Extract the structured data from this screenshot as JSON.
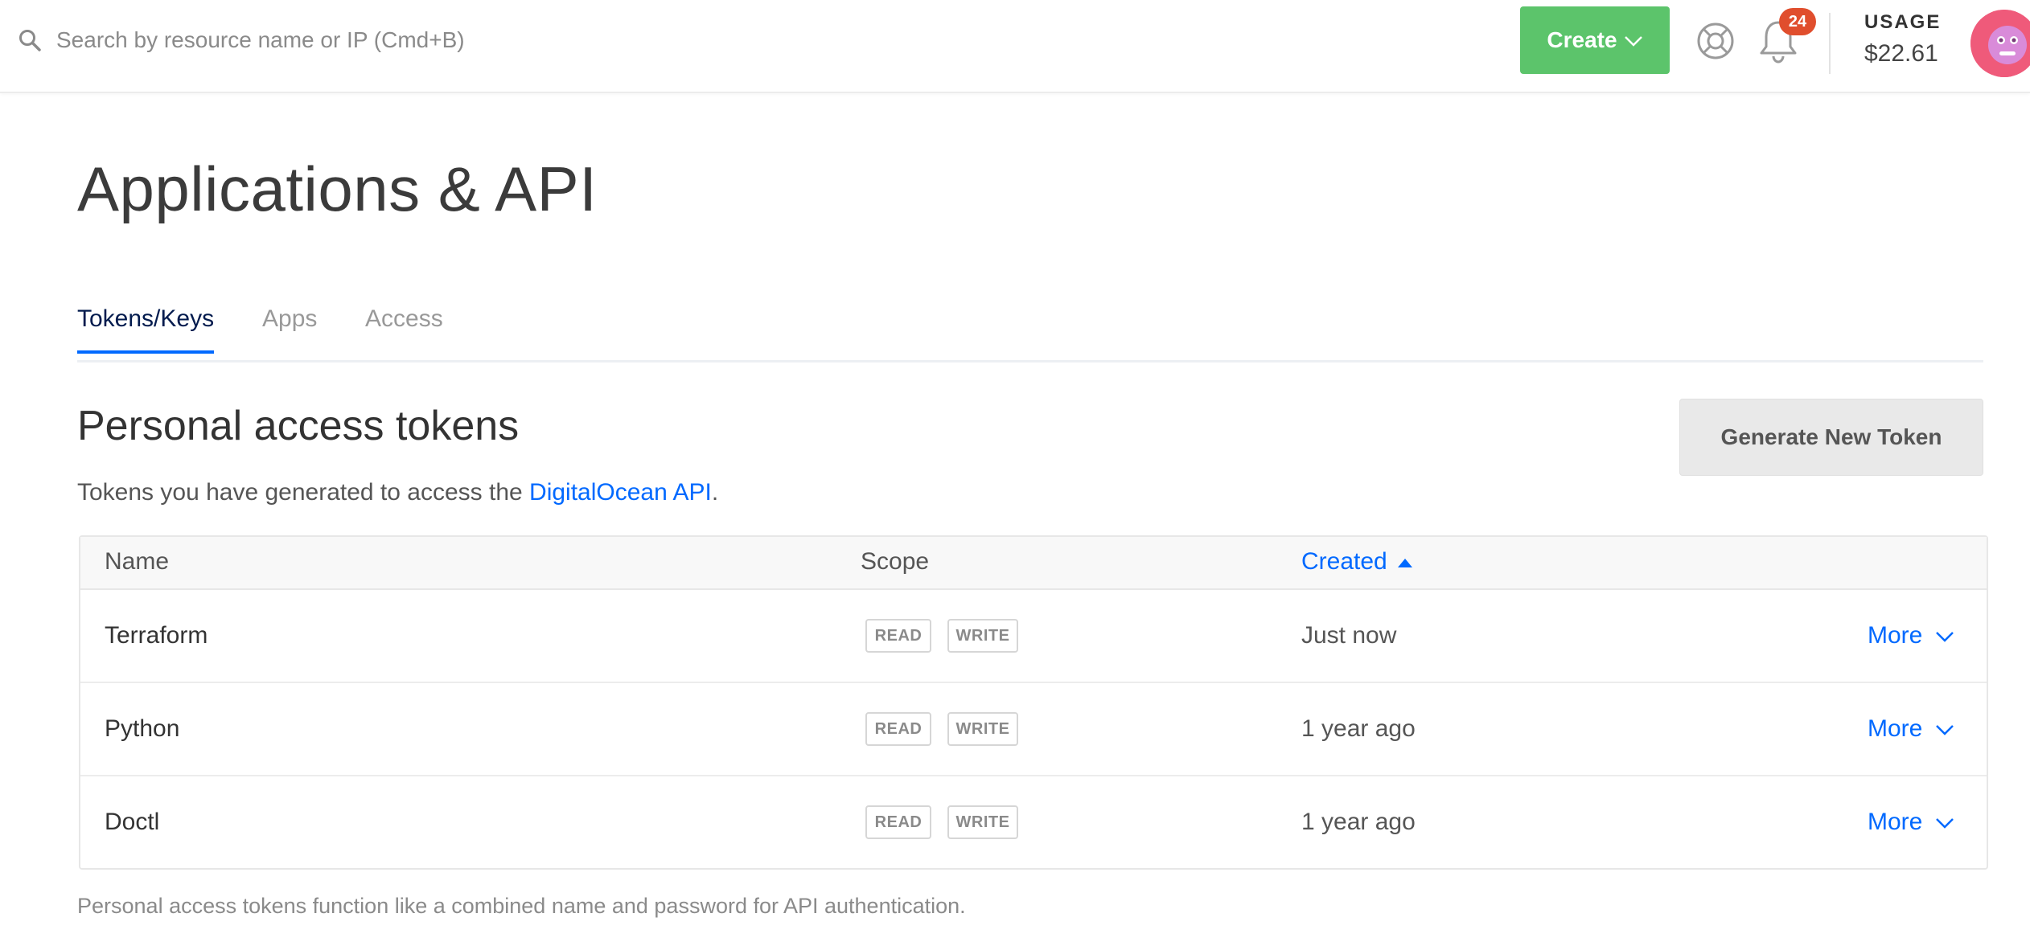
{
  "search": {
    "placeholder": "Search by resource name or IP (Cmd+B)",
    "icon": "search-icon"
  },
  "header": {
    "create_label": "Create",
    "notifications_count": "24",
    "usage_label": "USAGE",
    "usage_amount": "$22.61"
  },
  "page": {
    "title": "Applications & API"
  },
  "tabs": [
    {
      "label": "Tokens/Keys",
      "active": true
    },
    {
      "label": "Apps",
      "active": false
    },
    {
      "label": "Access",
      "active": false
    }
  ],
  "section": {
    "title": "Personal access tokens",
    "subtitle_prefix": "Tokens you have generated to access the ",
    "subtitle_link": "DigitalOcean API",
    "subtitle_suffix": ".",
    "generate_button": "Generate New Token"
  },
  "table": {
    "columns": {
      "name": "Name",
      "scope": "Scope",
      "created": "Created"
    },
    "rows": [
      {
        "name": "Terraform",
        "scopes": [
          "READ",
          "WRITE"
        ],
        "created": "Just now",
        "action": "More"
      },
      {
        "name": "Python",
        "scopes": [
          "READ",
          "WRITE"
        ],
        "created": "1 year ago",
        "action": "More"
      },
      {
        "name": "Doctl",
        "scopes": [
          "READ",
          "WRITE"
        ],
        "created": "1 year ago",
        "action": "More"
      }
    ]
  },
  "footnote": "Personal access tokens function like a combined name and password for API authentication.",
  "colors": {
    "accent": "#0069ff",
    "create_green": "#5cc46b",
    "badge_red": "#e04e2d",
    "avatar_pink": "#ef5a7a"
  }
}
